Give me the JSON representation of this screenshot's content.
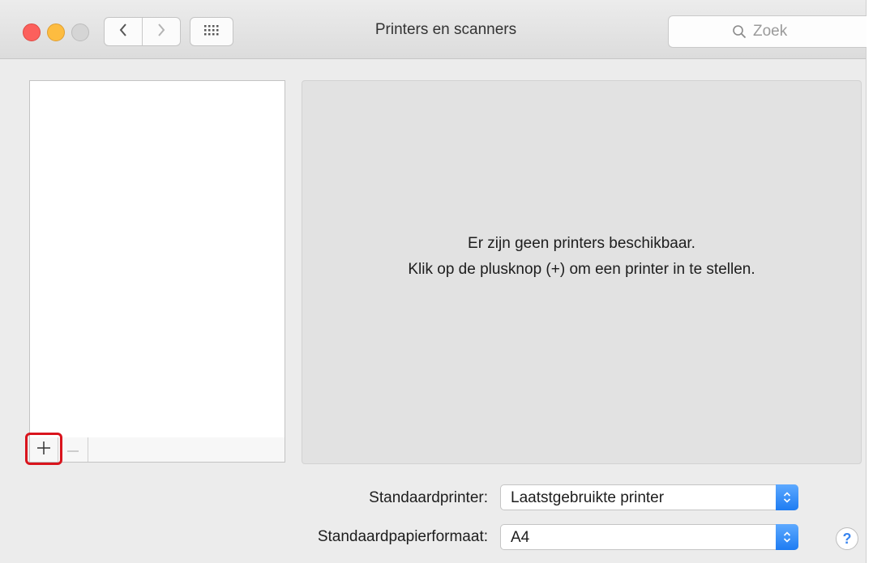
{
  "window": {
    "title": "Printers en scanners"
  },
  "search": {
    "placeholder": "Zoek"
  },
  "printer_list": {
    "add_label": "+",
    "remove_label": "−"
  },
  "detail": {
    "message_line1": "Er zijn geen printers beschikbaar.",
    "message_line2": "Klik op de plusknop (+) om een printer in te stellen."
  },
  "settings": {
    "default_printer_label": "Standaardprinter:",
    "default_printer_value": "Laatstgebruikte printer",
    "default_paper_label": "Standaardpapierformaat:",
    "default_paper_value": "A4"
  },
  "help": {
    "label": "?"
  },
  "colors": {
    "highlight": "#d9141d",
    "accent": "#1e7cf2"
  }
}
